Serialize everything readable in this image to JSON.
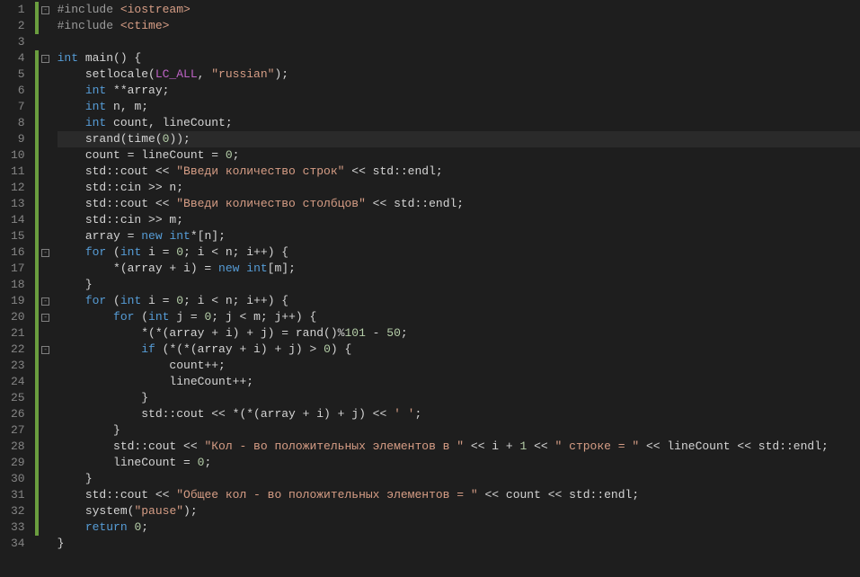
{
  "chart_data": null,
  "code": {
    "lines": [
      {
        "n": 1,
        "fold": "open",
        "mark": true,
        "tokens": [
          [
            "inc",
            "#include "
          ],
          [
            "str",
            "<iostream>"
          ]
        ]
      },
      {
        "n": 2,
        "fold": "",
        "mark": true,
        "tokens": [
          [
            "inc",
            "#include "
          ],
          [
            "str",
            "<ctime>"
          ]
        ]
      },
      {
        "n": 3,
        "fold": "",
        "mark": false,
        "tokens": []
      },
      {
        "n": 4,
        "fold": "open",
        "mark": true,
        "tokens": [
          [
            "type",
            "int"
          ],
          [
            "id",
            " main() {"
          ]
        ]
      },
      {
        "n": 5,
        "fold": "",
        "mark": true,
        "tokens": [
          [
            "id",
            "    setlocale("
          ],
          [
            "def",
            "LC_ALL"
          ],
          [
            "id",
            ", "
          ],
          [
            "str",
            "\"russian\""
          ],
          [
            "id",
            ");"
          ]
        ]
      },
      {
        "n": 6,
        "fold": "",
        "mark": true,
        "tokens": [
          [
            "id",
            "    "
          ],
          [
            "type",
            "int"
          ],
          [
            "id",
            " **array;"
          ]
        ]
      },
      {
        "n": 7,
        "fold": "",
        "mark": true,
        "tokens": [
          [
            "id",
            "    "
          ],
          [
            "type",
            "int"
          ],
          [
            "id",
            " n, m;"
          ]
        ]
      },
      {
        "n": 8,
        "fold": "",
        "mark": true,
        "tokens": [
          [
            "id",
            "    "
          ],
          [
            "type",
            "int"
          ],
          [
            "id",
            " count, lineCount;"
          ]
        ]
      },
      {
        "n": 9,
        "fold": "",
        "mark": true,
        "cur": true,
        "tokens": [
          [
            "id",
            "    srand(time("
          ],
          [
            "num",
            "0"
          ],
          [
            "id",
            "));"
          ]
        ]
      },
      {
        "n": 10,
        "fold": "",
        "mark": true,
        "tokens": [
          [
            "id",
            "    count = lineCount = "
          ],
          [
            "num",
            "0"
          ],
          [
            "id",
            ";"
          ]
        ]
      },
      {
        "n": 11,
        "fold": "",
        "mark": true,
        "tokens": [
          [
            "id",
            "    std::cout << "
          ],
          [
            "str",
            "\"Введи количество строк\""
          ],
          [
            "id",
            " << std::endl;"
          ]
        ]
      },
      {
        "n": 12,
        "fold": "",
        "mark": true,
        "tokens": [
          [
            "id",
            "    std::cin >> n;"
          ]
        ]
      },
      {
        "n": 13,
        "fold": "",
        "mark": true,
        "tokens": [
          [
            "id",
            "    std::cout << "
          ],
          [
            "str",
            "\"Введи количество столбцов\""
          ],
          [
            "id",
            " << std::endl;"
          ]
        ]
      },
      {
        "n": 14,
        "fold": "",
        "mark": true,
        "tokens": [
          [
            "id",
            "    std::cin >> m;"
          ]
        ]
      },
      {
        "n": 15,
        "fold": "",
        "mark": true,
        "tokens": [
          [
            "id",
            "    array = "
          ],
          [
            "kw",
            "new"
          ],
          [
            "id",
            " "
          ],
          [
            "type",
            "int"
          ],
          [
            "id",
            "*[n];"
          ]
        ]
      },
      {
        "n": 16,
        "fold": "open",
        "mark": true,
        "tokens": [
          [
            "id",
            "    "
          ],
          [
            "kw",
            "for"
          ],
          [
            "id",
            " ("
          ],
          [
            "type",
            "int"
          ],
          [
            "id",
            " i = "
          ],
          [
            "num",
            "0"
          ],
          [
            "id",
            "; i < n; i++) {"
          ]
        ]
      },
      {
        "n": 17,
        "fold": "",
        "mark": true,
        "tokens": [
          [
            "id",
            "        *(array + i) = "
          ],
          [
            "kw",
            "new"
          ],
          [
            "id",
            " "
          ],
          [
            "type",
            "int"
          ],
          [
            "id",
            "[m];"
          ]
        ]
      },
      {
        "n": 18,
        "fold": "",
        "mark": true,
        "tokens": [
          [
            "id",
            "    }"
          ]
        ]
      },
      {
        "n": 19,
        "fold": "open",
        "mark": true,
        "tokens": [
          [
            "id",
            "    "
          ],
          [
            "kw",
            "for"
          ],
          [
            "id",
            " ("
          ],
          [
            "type",
            "int"
          ],
          [
            "id",
            " i = "
          ],
          [
            "num",
            "0"
          ],
          [
            "id",
            "; i < n; i++) {"
          ]
        ]
      },
      {
        "n": 20,
        "fold": "open",
        "mark": true,
        "tokens": [
          [
            "id",
            "        "
          ],
          [
            "kw",
            "for"
          ],
          [
            "id",
            " ("
          ],
          [
            "type",
            "int"
          ],
          [
            "id",
            " j = "
          ],
          [
            "num",
            "0"
          ],
          [
            "id",
            "; j < m; j++) {"
          ]
        ]
      },
      {
        "n": 21,
        "fold": "",
        "mark": true,
        "tokens": [
          [
            "id",
            "            *(*(array + i) + j) = rand()%"
          ],
          [
            "num",
            "101"
          ],
          [
            "id",
            " - "
          ],
          [
            "num",
            "50"
          ],
          [
            "id",
            ";"
          ]
        ]
      },
      {
        "n": 22,
        "fold": "open",
        "mark": true,
        "tokens": [
          [
            "id",
            "            "
          ],
          [
            "kw",
            "if"
          ],
          [
            "id",
            " (*(*(array + i) + j) > "
          ],
          [
            "num",
            "0"
          ],
          [
            "id",
            ") {"
          ]
        ]
      },
      {
        "n": 23,
        "fold": "",
        "mark": true,
        "tokens": [
          [
            "id",
            "                count++;"
          ]
        ]
      },
      {
        "n": 24,
        "fold": "",
        "mark": true,
        "tokens": [
          [
            "id",
            "                lineCount++;"
          ]
        ]
      },
      {
        "n": 25,
        "fold": "",
        "mark": true,
        "tokens": [
          [
            "id",
            "            }"
          ]
        ]
      },
      {
        "n": 26,
        "fold": "",
        "mark": true,
        "tokens": [
          [
            "id",
            "            std::cout << *(*(array + i) + j) << "
          ],
          [
            "str",
            "' '"
          ],
          [
            "id",
            ";"
          ]
        ]
      },
      {
        "n": 27,
        "fold": "",
        "mark": true,
        "tokens": [
          [
            "id",
            "        }"
          ]
        ]
      },
      {
        "n": 28,
        "fold": "",
        "mark": true,
        "tokens": [
          [
            "id",
            "        std::cout << "
          ],
          [
            "str",
            "\"Кол - во положительных элементов в \""
          ],
          [
            "id",
            " << i + "
          ],
          [
            "num",
            "1"
          ],
          [
            "id",
            " << "
          ],
          [
            "str",
            "\" строке = \""
          ],
          [
            "id",
            " << lineCount << std::endl;"
          ]
        ]
      },
      {
        "n": 29,
        "fold": "",
        "mark": true,
        "tokens": [
          [
            "id",
            "        lineCount = "
          ],
          [
            "num",
            "0"
          ],
          [
            "id",
            ";"
          ]
        ]
      },
      {
        "n": 30,
        "fold": "",
        "mark": true,
        "tokens": [
          [
            "id",
            "    }"
          ]
        ]
      },
      {
        "n": 31,
        "fold": "",
        "mark": true,
        "tokens": [
          [
            "id",
            "    std::cout << "
          ],
          [
            "str",
            "\"Общее кол - во положительных элементов = \""
          ],
          [
            "id",
            " << count << std::endl;"
          ]
        ]
      },
      {
        "n": 32,
        "fold": "",
        "mark": true,
        "tokens": [
          [
            "id",
            "    system("
          ],
          [
            "str",
            "\"pause\""
          ],
          [
            "id",
            ");"
          ]
        ]
      },
      {
        "n": 33,
        "fold": "",
        "mark": true,
        "tokens": [
          [
            "id",
            "    "
          ],
          [
            "kw",
            "return"
          ],
          [
            "id",
            " "
          ],
          [
            "num",
            "0"
          ],
          [
            "id",
            ";"
          ]
        ]
      },
      {
        "n": 34,
        "fold": "",
        "mark": false,
        "tokens": [
          [
            "id",
            "}"
          ]
        ]
      }
    ]
  }
}
